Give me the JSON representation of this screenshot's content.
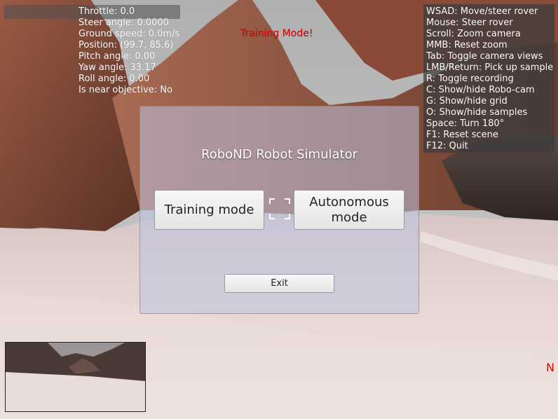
{
  "telemetry": {
    "lines": [
      "Throttle: 0.0",
      "Steer angle: 0.0000",
      "Ground speed: 0.0m/s",
      "Position: (99.7, 85.6)",
      "Pitch angle: 0.00",
      "Yaw angle: 33.17",
      "Roll angle: 0.00",
      "Is near objective: No"
    ]
  },
  "controls_help": {
    "lines": [
      "WSAD: Move/steer rover",
      "Mouse: Steer rover",
      "Scroll: Zoom camera",
      "MMB: Reset zoom",
      "Tab: Toggle camera views",
      "LMB/Return: Pick up sample",
      "R: Toggle recording",
      "C: Show/hide Robo-cam",
      "G: Show/hide grid",
      "O: Show/hide samples",
      "Space: Turn 180°",
      "F1: Reset scene",
      "F12: Quit"
    ]
  },
  "mode_indicator": "Training Mode!",
  "edge_indicator": "N",
  "dialog": {
    "title": "RoboND Robot Simulator",
    "training_button": "Training mode",
    "autonomous_button": "Autonomous\nmode",
    "exit_button": "Exit"
  },
  "colors": {
    "mode_text": "#e00000",
    "sky": "#bdbdbd",
    "ground": "#e9d8d4",
    "rock": "#8a5040"
  }
}
